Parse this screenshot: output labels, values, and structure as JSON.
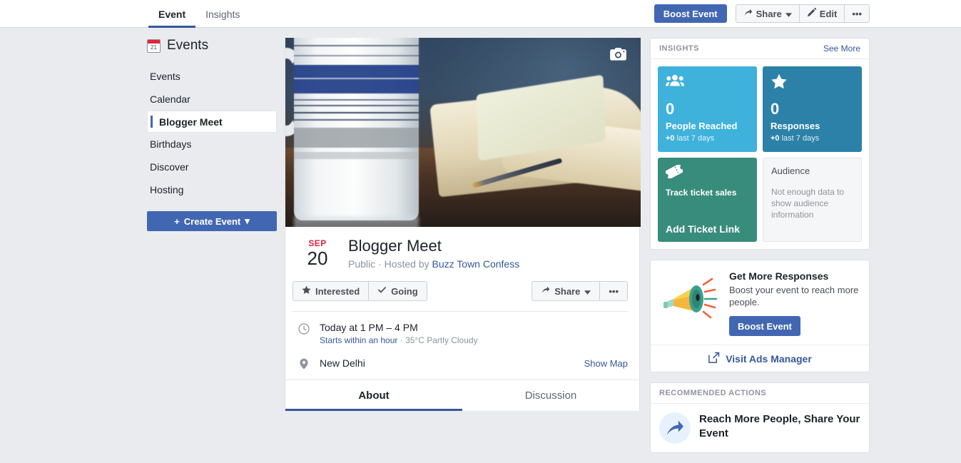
{
  "topbar": {
    "tabs": [
      {
        "label": "Event",
        "active": true
      },
      {
        "label": "Insights",
        "active": false
      }
    ],
    "boost_label": "Boost Event",
    "share_label": "Share",
    "edit_label": "Edit",
    "more_label": "•••"
  },
  "sidebar": {
    "title": "Events",
    "calendar_day": "21",
    "items": [
      {
        "label": "Events",
        "active": false
      },
      {
        "label": "Calendar",
        "active": false
      },
      {
        "label": "Blogger Meet",
        "active": true
      },
      {
        "label": "Birthdays",
        "active": false
      },
      {
        "label": "Discover",
        "active": false
      },
      {
        "label": "Hosting",
        "active": false
      }
    ],
    "create_label": "Create Event",
    "create_plus": "+",
    "create_caret": "▾"
  },
  "event": {
    "month": "SEP",
    "day": "20",
    "title": "Blogger Meet",
    "privacy": "Public",
    "hosted_by_prefix": "· Hosted by",
    "host": "Buzz Town Confess",
    "interested_label": "Interested",
    "going_label": "Going",
    "share_label": "Share",
    "more_label": "•••",
    "time": "Today at 1 PM – 4 PM",
    "starts_link": "Starts within an hour",
    "weather": "· 35°C Partly Cloudy",
    "location": "New Delhi",
    "show_map": "Show Map",
    "tabs": [
      {
        "label": "About",
        "active": true
      },
      {
        "label": "Discussion",
        "active": false
      }
    ]
  },
  "insights": {
    "header": "INSIGHTS",
    "see_more": "See More",
    "tiles": [
      {
        "icon": "people-icon",
        "value": "0",
        "label": "People Reached",
        "delta_bold": "+0",
        "delta_rest": "last 7 days",
        "color": "#3fb2dc"
      },
      {
        "icon": "star-icon",
        "value": "0",
        "label": "Responses",
        "delta_bold": "+0",
        "delta_rest": "last 7 days",
        "color": "#2c81a8"
      }
    ],
    "ticket": {
      "icon": "ticket-icon",
      "top_label": "Track ticket sales",
      "bottom_label": "Add Ticket Link",
      "color": "#388c7b"
    },
    "audience": {
      "title": "Audience",
      "text": "Not enough data to show audience information"
    }
  },
  "boost": {
    "title": "Get More Responses",
    "text": "Boost your event to reach more people.",
    "button": "Boost Event",
    "ads_manager": "Visit Ads Manager"
  },
  "recommended": {
    "header": "RECOMMENDED ACTIONS",
    "item_title": "Reach More People, Share Your Event"
  },
  "colors": {
    "brand_blue": "#4267b2",
    "link_blue": "#365899",
    "page_bg": "#e9ebee",
    "red": "#e0243c"
  }
}
